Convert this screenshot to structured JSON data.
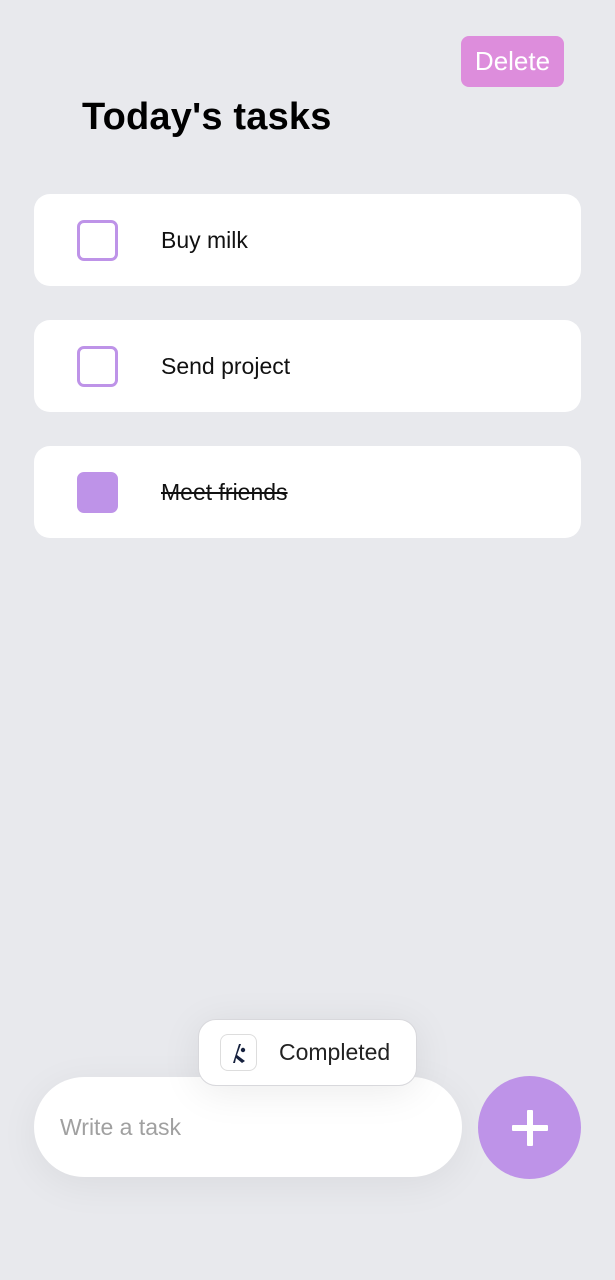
{
  "header": {
    "delete_label": "Delete",
    "title": "Today's tasks"
  },
  "tasks": [
    {
      "label": "Buy milk",
      "completed": false
    },
    {
      "label": "Send project",
      "completed": false
    },
    {
      "label": "Meet friends",
      "completed": true
    }
  ],
  "toast": {
    "icon": "app-logo-icon",
    "label": "Completed"
  },
  "composer": {
    "placeholder": "Write a task",
    "value": "",
    "add_icon": "plus-icon"
  },
  "colors": {
    "background": "#e8e9ed",
    "accent": "#be93e8",
    "delete": "#dd8ddc"
  }
}
